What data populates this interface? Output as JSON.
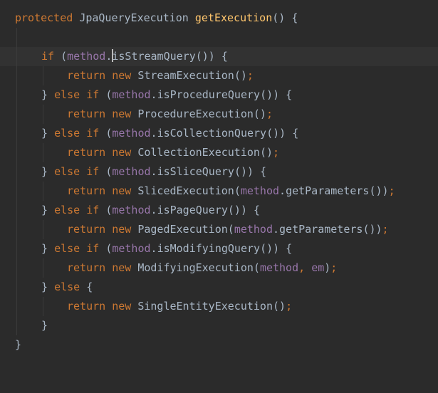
{
  "code": {
    "l0": {
      "kw1": "protected",
      "type": "JpaQueryExecution",
      "fn": "getExecution",
      "rest": "() {"
    },
    "l2": {
      "kw1": "if",
      "p1": "(",
      "field": "method",
      "dot": ".",
      "call": "isStreamQuery",
      "rest": "()) {"
    },
    "l3": {
      "kw1": "return",
      "kw2": "new",
      "cls": "StreamExecution",
      "rest": "()",
      "semi": ";"
    },
    "l4": {
      "b": "}",
      "kw1": "else",
      "kw2": "if",
      "p1": "(",
      "field": "method",
      "dot": ".",
      "call": "isProcedureQuery",
      "rest": "()) {"
    },
    "l5": {
      "kw1": "return",
      "kw2": "new",
      "cls": "ProcedureExecution",
      "rest": "()",
      "semi": ";"
    },
    "l6": {
      "b": "}",
      "kw1": "else",
      "kw2": "if",
      "p1": "(",
      "field": "method",
      "dot": ".",
      "call": "isCollectionQuery",
      "rest": "()) {"
    },
    "l7": {
      "kw1": "return",
      "kw2": "new",
      "cls": "CollectionExecution",
      "rest": "()",
      "semi": ";"
    },
    "l8": {
      "b": "}",
      "kw1": "else",
      "kw2": "if",
      "p1": "(",
      "field": "method",
      "dot": ".",
      "call": "isSliceQuery",
      "rest": "()) {"
    },
    "l9": {
      "kw1": "return",
      "kw2": "new",
      "cls": "SlicedExecution",
      "p1": "(",
      "field": "method",
      "dot": ".",
      "call": "getParameters",
      "rest": "())",
      "semi": ";"
    },
    "l10": {
      "b": "}",
      "kw1": "else",
      "kw2": "if",
      "p1": "(",
      "field": "method",
      "dot": ".",
      "call": "isPageQuery",
      "rest": "()) {"
    },
    "l11": {
      "kw1": "return",
      "kw2": "new",
      "cls": "PagedExecution",
      "p1": "(",
      "field": "method",
      "dot": ".",
      "call": "getParameters",
      "rest": "())",
      "semi": ";"
    },
    "l12": {
      "b": "}",
      "kw1": "else",
      "kw2": "if",
      "p1": "(",
      "field": "method",
      "dot": ".",
      "call": "isModifyingQuery",
      "rest": "()) {"
    },
    "l13": {
      "kw1": "return",
      "kw2": "new",
      "cls": "ModifyingExecution",
      "p1": "(",
      "field": "method",
      "comma": ",",
      "arg": "em",
      "rest": ")",
      "semi": ";"
    },
    "l14": {
      "b": "}",
      "kw1": "else",
      "rest": "{"
    },
    "l15": {
      "kw1": "return",
      "kw2": "new",
      "cls": "SingleEntityExecution",
      "rest": "()",
      "semi": ";"
    },
    "l16": {
      "b": "}"
    },
    "l17": {
      "b": "}"
    }
  }
}
